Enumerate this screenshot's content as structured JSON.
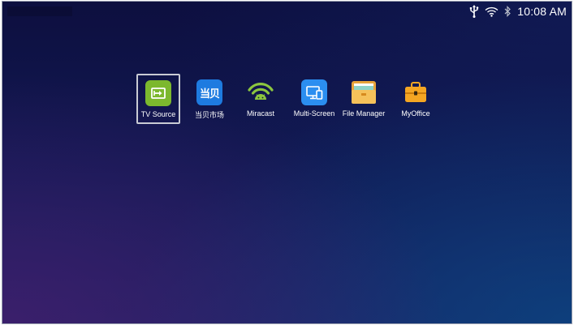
{
  "status_bar": {
    "time": "10:08 AM",
    "icons": [
      "usb-icon",
      "wifi-icon",
      "bluetooth-icon"
    ]
  },
  "apps": [
    {
      "label": "TV Source",
      "icon": "tv-source-icon",
      "selected": true
    },
    {
      "label": "当贝市场",
      "icon": "dangbei-market-icon",
      "icon_text": "当贝"
    },
    {
      "label": "Miracast",
      "icon": "miracast-icon"
    },
    {
      "label": "Multi-Screen",
      "icon": "multi-screen-icon"
    },
    {
      "label": "File Manager",
      "icon": "folder-icon"
    },
    {
      "label": "MyOffice",
      "icon": "briefcase-icon"
    }
  ],
  "colors": {
    "background": "#121a55",
    "tv_source": "#7cb82e",
    "dangbei": "#1e7be0",
    "miracast": "#8cc63f",
    "multi_screen": "#2b8ef0",
    "folder": "#f2b84b",
    "briefcase": "#f4a623"
  }
}
